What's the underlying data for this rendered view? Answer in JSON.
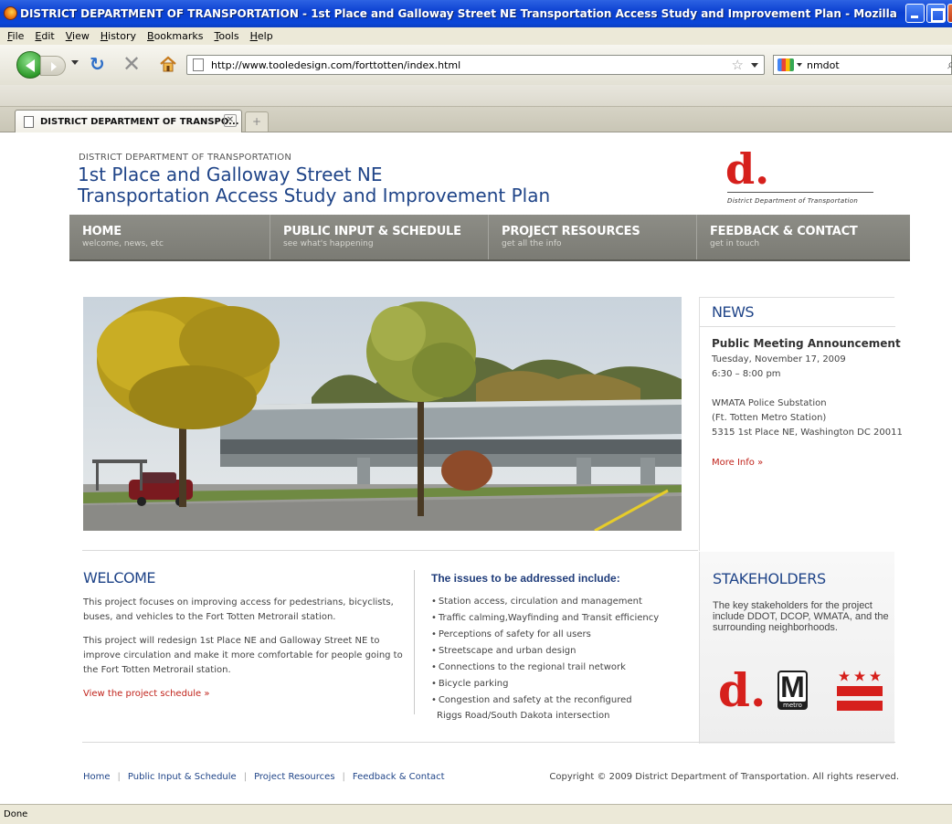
{
  "window": {
    "title": "DISTRICT DEPARTMENT OF TRANSPORTATION - 1st Place and Galloway Street NE Transportation Access Study and Improvement Plan - Mozilla Firefox"
  },
  "menu": [
    "File",
    "Edit",
    "View",
    "History",
    "Bookmarks",
    "Tools",
    "Help"
  ],
  "navbar": {
    "url": "http://www.tooledesign.com/forttotten/index.html",
    "search_value": "nmdot"
  },
  "tabs": [
    {
      "title": "DISTRICT DEPARTMENT OF TRANSPO..."
    }
  ],
  "site": {
    "agency": "DISTRICT DEPARTMENT OF TRANSPORTATION",
    "title_line1": "1st Place and Galloway Street NE",
    "title_line2": "Transportation Access Study and Improvement Plan",
    "logo_letter": "d.",
    "logo_caption": "District Department of Transportation"
  },
  "mainnav": [
    {
      "label": "HOME",
      "sub": "welcome, news, etc"
    },
    {
      "label": "PUBLIC INPUT & SCHEDULE",
      "sub": "see what's happening"
    },
    {
      "label": "PROJECT RESOURCES",
      "sub": "get all the info"
    },
    {
      "label": "FEEDBACK & CONTACT",
      "sub": "get in touch"
    }
  ],
  "news": {
    "heading": "NEWS",
    "event_title": "Public Meeting Announcement",
    "date": "Tuesday, November 17, 2009",
    "time": "6:30 – 8:00 pm",
    "venue1": "WMATA Police Substation",
    "venue2": "(Ft. Totten Metro Station)",
    "address": "5315 1st Place NE, Washington DC 20011",
    "more": "More Info »"
  },
  "welcome": {
    "heading": "WELCOME",
    "p1": "This project focuses on improving access for pedestrians, bicyclists, buses, and vehicles to the Fort Totten Metrorail station.",
    "p2": "This project will redesign 1st Place NE and Galloway Street NE to improve circulation and make it more comfortable for people going to the Fort Totten Metrorail station.",
    "schedule_link": "View the project schedule »"
  },
  "issues": {
    "heading": "The issues to be addressed include:",
    "items": [
      "Station access, circulation and management",
      "Traffic calming,Wayfinding and Transit efficiency",
      "Perceptions of safety for all users",
      "Streetscape and urban design",
      "Connections to the regional trail network",
      "Bicycle parking",
      "Congestion and safety at the reconfigured"
    ],
    "item_continuation": "Riggs Road/South Dakota intersection"
  },
  "stakeholders": {
    "heading": "STAKEHOLDERS",
    "text": "The key stakeholders for the project include DDOT, DCOP, WMATA, and the surrounding neighborhoods.",
    "ddot_letter": "d.",
    "metro_letter": "M",
    "metro_word": "metro"
  },
  "footer": {
    "links": [
      "Home",
      "Public Input & Schedule",
      "Project Resources",
      "Feedback & Contact"
    ],
    "copyright": "Copyright © 2009 District Department of Transportation. All rights reserved."
  },
  "status": "Done",
  "colors": {
    "heading_blue": "#1f4488",
    "link_red": "#c0231b",
    "nav_gray": "#858580",
    "ddot_red": "#d6201c"
  }
}
